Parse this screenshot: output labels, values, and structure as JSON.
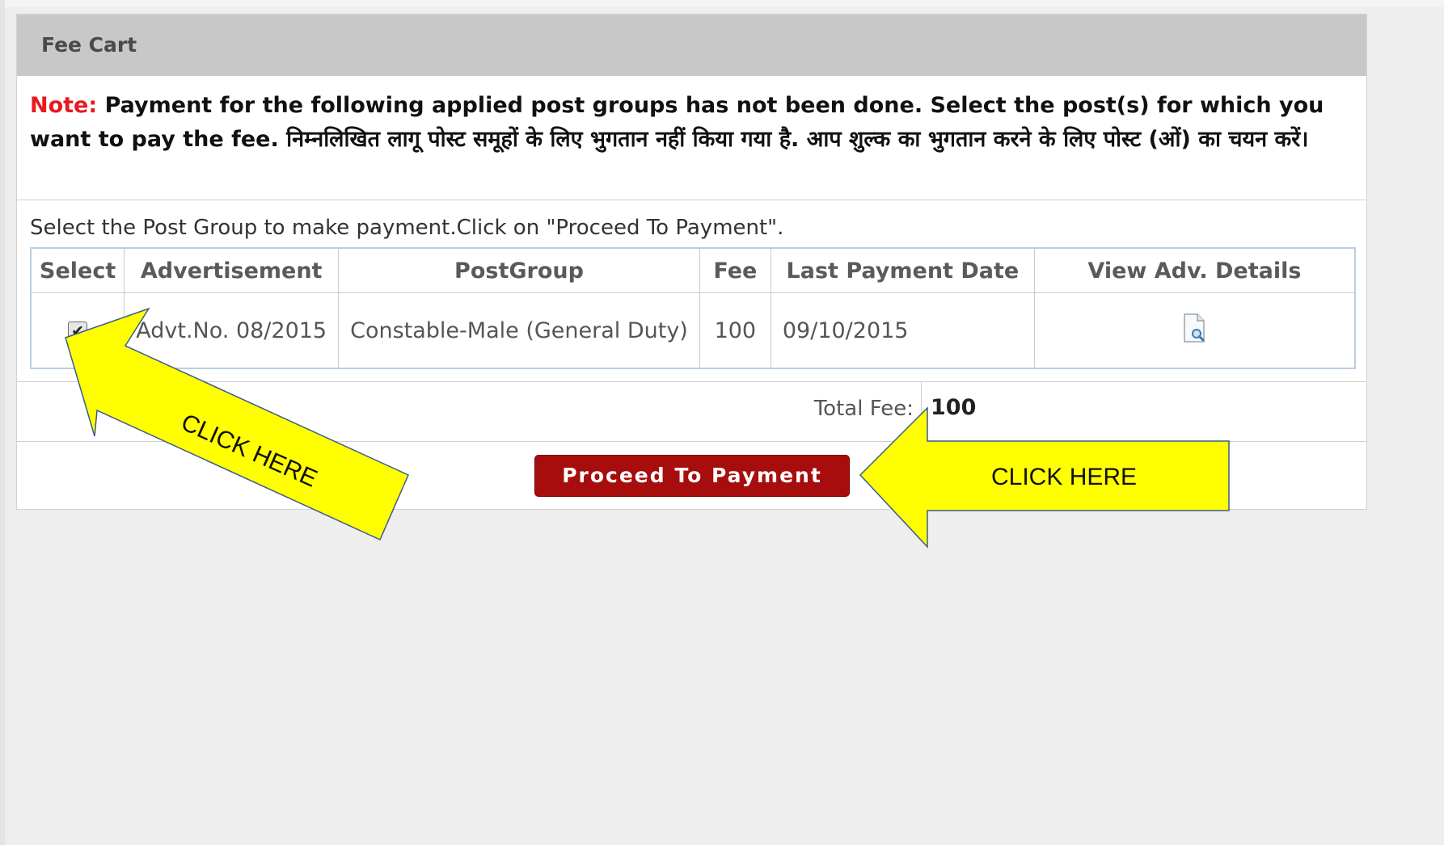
{
  "panel": {
    "title": "Fee Cart",
    "note_label": "Note:",
    "note_text": " Payment for the following applied post groups has not been done. Select the post(s) for which you want to pay the fee. निम्नलिखित लागू पोस्ट समूहों के लिए भुगतान नहीं किया गया है. आप शुल्क का भुगतान करने के लिए पोस्ट (ओं) का चयन करें।"
  },
  "instructions": "Select the Post Group to make payment.Click on \"Proceed To Payment\".",
  "table": {
    "headers": {
      "select": "Select",
      "advertisement": "Advertisement",
      "postgroup": "PostGroup",
      "fee": "Fee",
      "last_payment_date": "Last Payment Date",
      "view_details": "View Adv. Details"
    },
    "rows": [
      {
        "selected": true,
        "checkbox_glyph": "✔",
        "advertisement": "Advt.No. 08/2015",
        "postgroup": "Constable-Male (General Duty)",
        "fee": "100",
        "last_payment_date": "09/10/2015",
        "details_icon": "document-view-icon"
      }
    ]
  },
  "total": {
    "label": "Total Fee:",
    "value": "100"
  },
  "proceed_button": "Proceed To Payment",
  "annotations": {
    "checkbox_arrow_text": "CLICK HERE",
    "button_arrow_text": "CLICK HERE",
    "arrow_color": "#ffff00"
  }
}
